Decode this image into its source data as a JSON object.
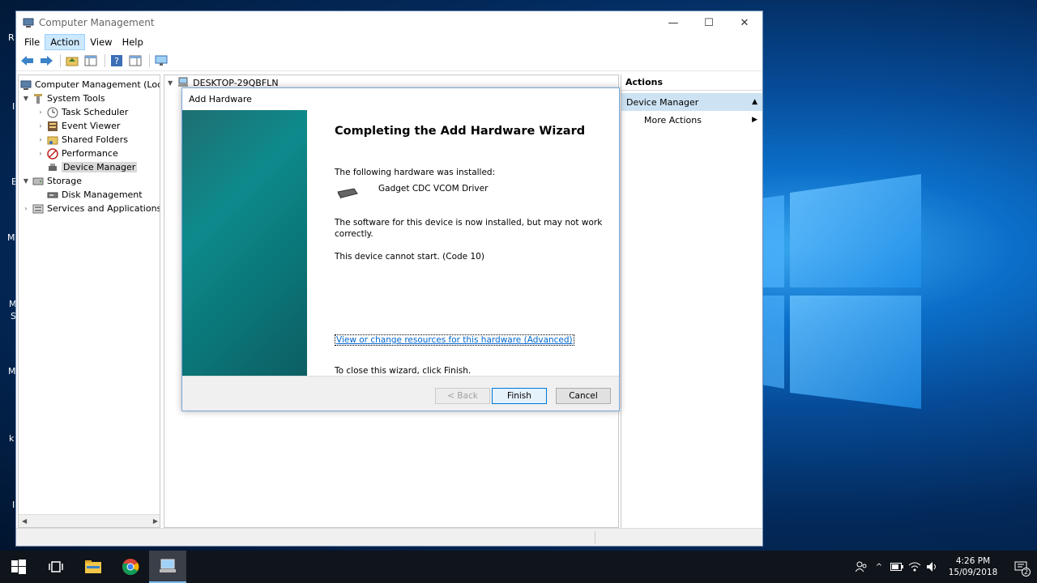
{
  "window": {
    "title": "Computer Management",
    "minimize": "—",
    "maximize": "☐",
    "close": "✕"
  },
  "menu": {
    "items": [
      "File",
      "Action",
      "View",
      "Help"
    ],
    "active": "Action"
  },
  "tree": {
    "root": "Computer Management (Local",
    "system_tools": "System Tools",
    "task_scheduler": "Task Scheduler",
    "event_viewer": "Event Viewer",
    "shared_folders": "Shared Folders",
    "performance": "Performance",
    "device_manager": "Device Manager",
    "storage": "Storage",
    "disk_management": "Disk Management",
    "services_apps": "Services and Applications"
  },
  "center": {
    "computer_name": "DESKTOP-29QBFLN"
  },
  "actions": {
    "header": "Actions",
    "section": "Device Manager",
    "more_actions": "More Actions"
  },
  "wizard": {
    "title": "Add Hardware",
    "heading": "Completing the Add Hardware Wizard",
    "installed_label": "The following hardware was installed:",
    "device_name": "Gadget CDC VCOM Driver",
    "status_line1": "The software for this device is now installed, but may not work",
    "status_line2": "correctly.",
    "error": "This device cannot start. (Code 10)",
    "link": "View or change resources for this hardware (Advanced)",
    "close_hint": "To close this wizard, click Finish.",
    "back_label": "< Back",
    "finish_label": "Finish",
    "cancel_label": "Cancel"
  },
  "desktop_strip": [
    "R",
    "I",
    "E",
    "M",
    "M",
    "S",
    "M",
    "k",
    "I"
  ],
  "taskbar": {
    "time": "4:26 PM",
    "date": "15/09/2018",
    "notification_count": "2"
  },
  "colors": {
    "accent": "#0078d7",
    "selection": "#cde3f4",
    "wizard_side": "#0e8a8c",
    "taskbar": "#10141b"
  }
}
